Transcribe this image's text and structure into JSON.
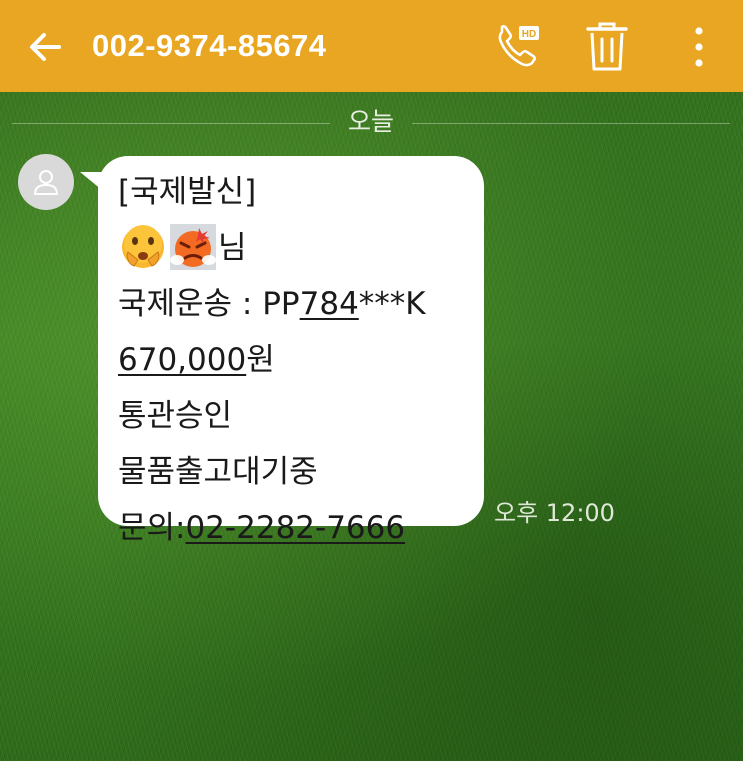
{
  "appbar": {
    "title": "002-9374-85674",
    "background": "#e8a623",
    "back_icon": "arrow-left-icon",
    "call_icon": "hd-call-icon",
    "delete_icon": "trash-icon",
    "more_icon": "more-vertical-icon"
  },
  "divider": {
    "date_label": "오늘"
  },
  "message": {
    "line1": "[국제발신]",
    "line2_suffix": "님",
    "line3_prefix": "국제운송 : PP",
    "line3_underlined": "784",
    "line3_suffix": "***K",
    "line4_underlined": "670,000",
    "line4_suffix": "원",
    "line5": "통관승인",
    "line6": "물품출고대기중",
    "line7_prefix": "문의:",
    "line7_underlined": "02-2282-7666",
    "emojis": [
      "shushing-face-emoji",
      "angry-face-emoji"
    ],
    "time": "오후 12:00"
  }
}
